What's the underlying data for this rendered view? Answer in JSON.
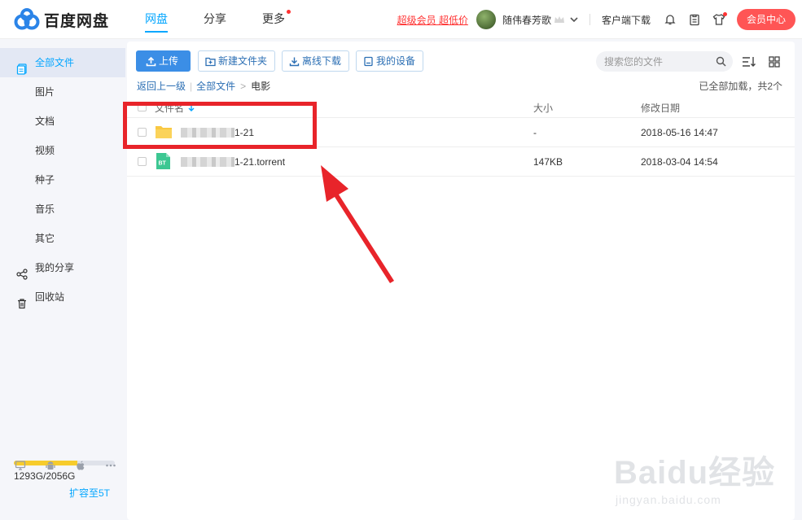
{
  "brand": {
    "name": "百度网盘"
  },
  "nav": {
    "items": [
      {
        "label": "网盘"
      },
      {
        "label": "分享"
      },
      {
        "label": "更多"
      }
    ]
  },
  "header": {
    "vip_promo": "超级会员 超低价",
    "username": "随伟春芳歌",
    "client_download": "客户端下载",
    "vip_center": "会员中心"
  },
  "sidebar": {
    "items": [
      {
        "label": "全部文件"
      },
      {
        "label": "图片"
      },
      {
        "label": "文档"
      },
      {
        "label": "视频"
      },
      {
        "label": "种子"
      },
      {
        "label": "音乐"
      },
      {
        "label": "其它"
      },
      {
        "label": "我的分享"
      },
      {
        "label": "回收站"
      }
    ],
    "quota": {
      "text": "1293G/2056G",
      "used_fraction": 0.629,
      "expand_label": "扩容至5T"
    }
  },
  "toolbar": {
    "upload": "上传",
    "new_folder": "新建文件夹",
    "offline_download": "离线下载",
    "my_devices": "我的设备",
    "search_placeholder": "搜索您的文件"
  },
  "breadcrumb": {
    "back": "返回上一级",
    "root": "全部文件",
    "current": "电影"
  },
  "loaded_status": "已全部加载，共2个",
  "table": {
    "headers": {
      "name": "文件名",
      "size": "大小",
      "date": "修改日期"
    },
    "rows": [
      {
        "name_suffix": "1-21",
        "size": "-",
        "date": "2018-05-16 14:47",
        "icon": "folder-icon"
      },
      {
        "name_suffix": "1-21.torrent",
        "size": "147KB",
        "date": "2018-03-04 14:54",
        "icon": "bt-torrent-icon"
      }
    ]
  },
  "watermark": {
    "text": "Baidu经验",
    "sub": "jingyan.baidu.com"
  },
  "colors": {
    "accent": "#06a7ff",
    "annotation": "#e8242a",
    "vip": "#ff5555",
    "folder": "#f9c842",
    "bt": "#3cc792"
  }
}
